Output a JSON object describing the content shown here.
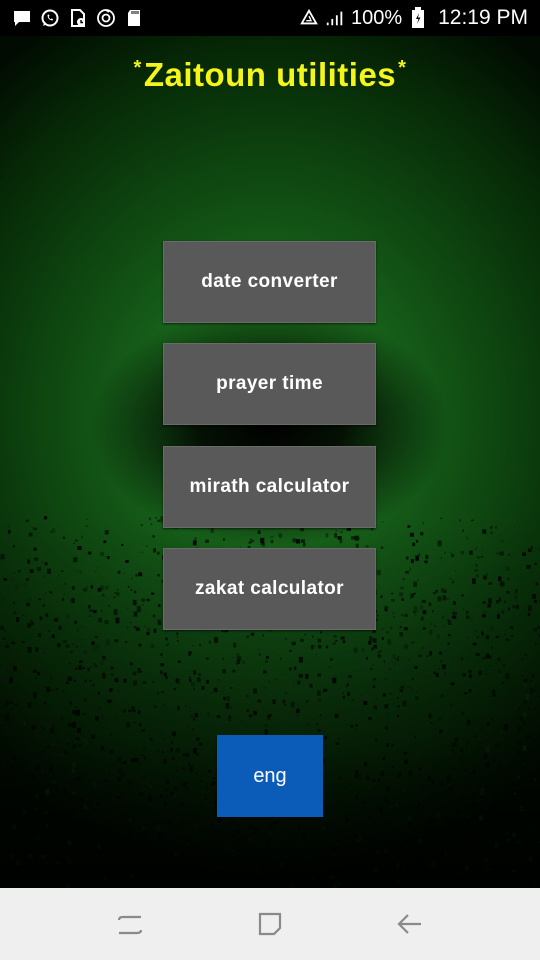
{
  "status_bar": {
    "left_icons": [
      "message-icon",
      "whatsapp-icon",
      "file-lock-icon",
      "sync-icon",
      "sd-card-icon"
    ],
    "right_icons": [
      "recycle-icon",
      "signal-icon",
      "battery-icon"
    ],
    "battery_percent": "100%",
    "time": "12:19 PM"
  },
  "app": {
    "title_prefix": "*",
    "title": "Zaitoun utilities",
    "title_suffix": "*",
    "title_color": "#f4f51c",
    "menu": [
      {
        "label": "date converter"
      },
      {
        "label": "prayer time"
      },
      {
        "label": "mirath calculator"
      },
      {
        "label": "zakat calculator"
      }
    ],
    "language_button": "eng",
    "menu_button_color": "#595959",
    "language_button_color": "#0b5cb8"
  },
  "nav_bar": {
    "buttons": [
      "recent-apps",
      "home",
      "back"
    ]
  }
}
